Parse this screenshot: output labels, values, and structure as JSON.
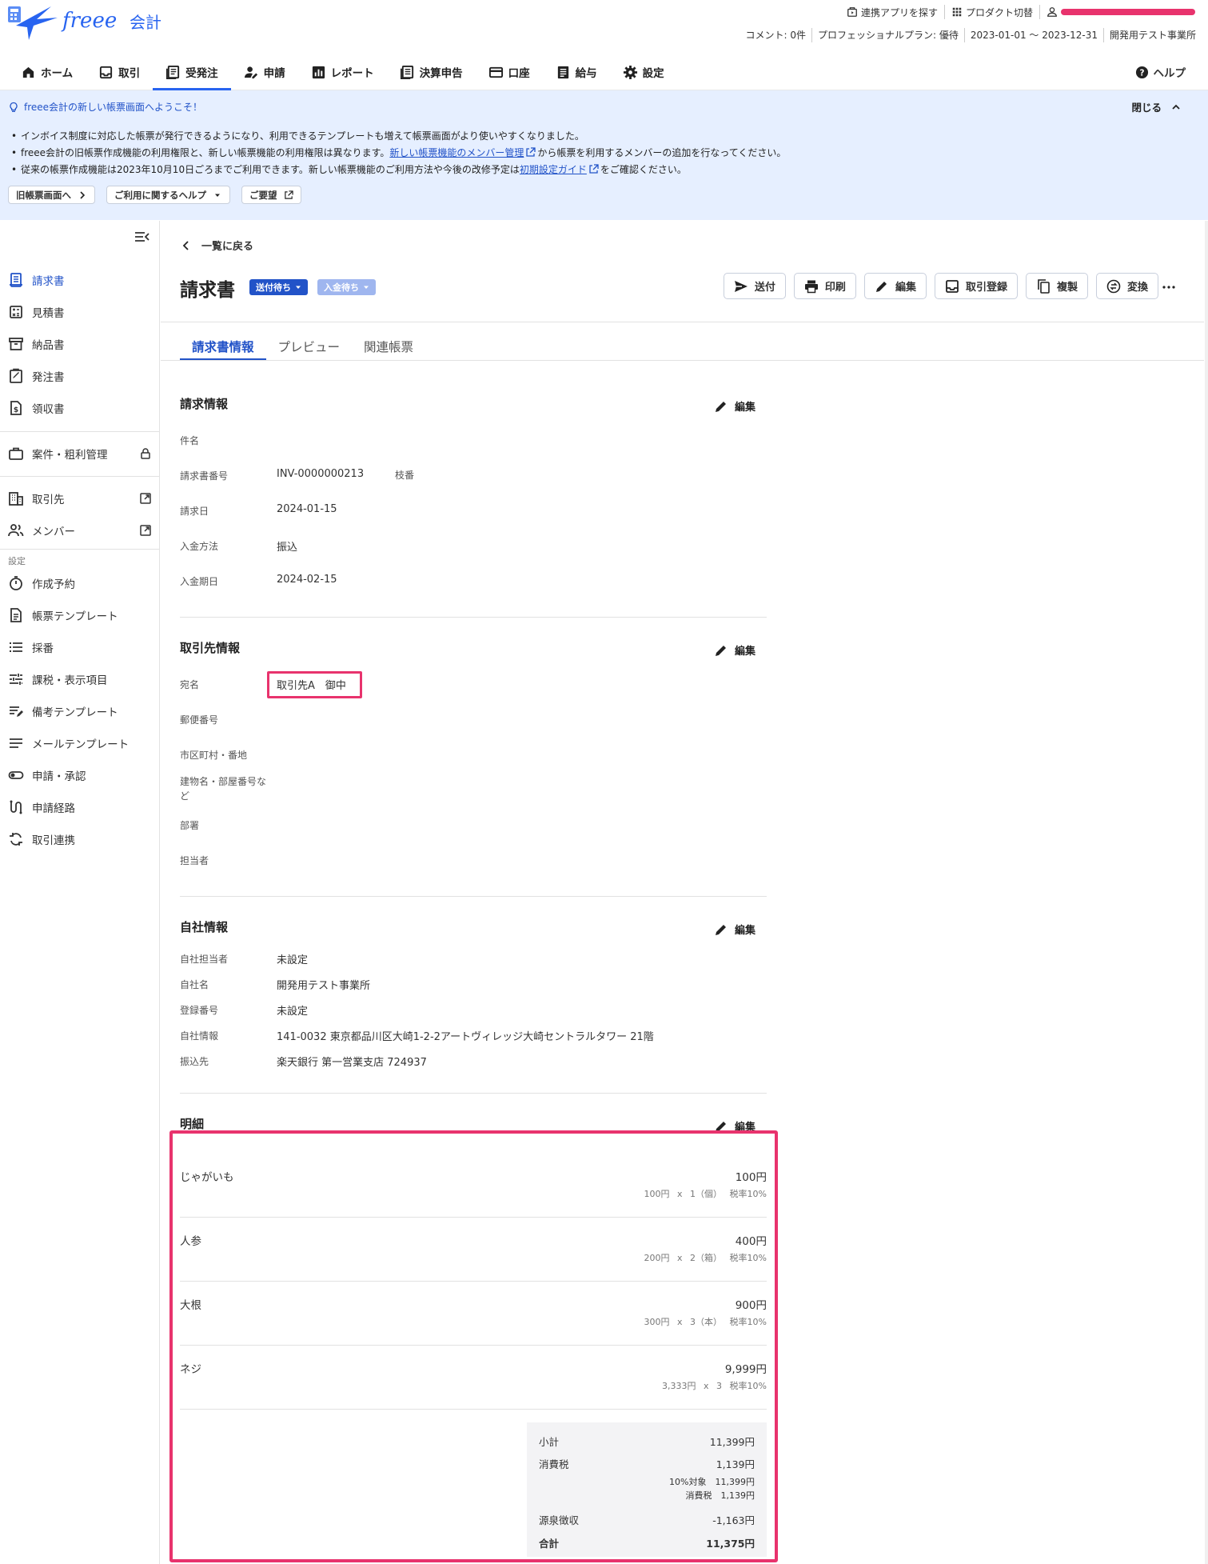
{
  "app": {
    "name": "freee 会計"
  },
  "header": {
    "tools": [
      {
        "icon": "app-store-icon",
        "label": "連携アプリを探す"
      },
      {
        "icon": "grid-icon",
        "label": "プロダクト切替"
      }
    ],
    "meta": [
      "コメント: 0件",
      "プロフェッショナルプラン: 優待",
      "2023-01-01 〜 2023-12-31",
      "開発用テスト事業所"
    ]
  },
  "nav": {
    "items": [
      {
        "label": "ホーム",
        "icon": "home-icon"
      },
      {
        "label": "取引",
        "icon": "transaction-icon"
      },
      {
        "label": "受発注",
        "icon": "orders-icon"
      },
      {
        "label": "申請",
        "icon": "request-icon"
      },
      {
        "label": "レポート",
        "icon": "report-icon"
      },
      {
        "label": "決算申告",
        "icon": "tax-filing-icon"
      },
      {
        "label": "口座",
        "icon": "account-icon"
      },
      {
        "label": "給与",
        "icon": "payroll-icon"
      },
      {
        "label": "設定",
        "icon": "gear-icon"
      }
    ],
    "active": "受発注",
    "help": "ヘルプ"
  },
  "banner": {
    "title": "freee会計の新しい帳票画面へようこそ！",
    "close": "閉じる",
    "line1": "インボイス制度に対応した帳票が発行できるようになり、利用できるテンプレートも増えて帳票画面がより使いやすくなりました。",
    "line2_pre": "freee会計の旧帳票作成機能の利用権限と、新しい帳票機能の利用権限は異なります。",
    "line2_link": "新しい帳票機能のメンバー管理",
    "line2_post": "から帳票を利用するメンバーの追加を行なってください。",
    "line3_pre": "従来の帳票作成機能は2023年10月10日ごろまでご利用できます。新しい帳票機能のご利用方法や今後の改修予定は",
    "line3_link": "初期設定ガイド",
    "line3_post": "をご確認ください。",
    "buttons": [
      "旧帳票画面へ",
      "ご利用に関するヘルプ",
      "ご要望"
    ]
  },
  "sidebar": {
    "items": [
      {
        "label": "請求書",
        "icon": "invoice-icon"
      },
      {
        "label": "見積書",
        "icon": "calculator-icon"
      },
      {
        "label": "納品書",
        "icon": "delivery-box-icon"
      },
      {
        "label": "発注書",
        "icon": "purchase-order-icon"
      },
      {
        "label": "領収書",
        "icon": "receipt-icon"
      },
      {
        "label": "案件・粗利管理",
        "icon": "briefcase-icon"
      },
      {
        "label": "取引先",
        "icon": "building-icon"
      },
      {
        "label": "メンバー",
        "icon": "members-icon"
      }
    ],
    "settings_heading": "設定",
    "settings": [
      {
        "label": "作成予約",
        "icon": "timer-icon"
      },
      {
        "label": "帳票テンプレート",
        "icon": "template-icon"
      },
      {
        "label": "採番",
        "icon": "numbered-list-icon"
      },
      {
        "label": "課税・表示項目",
        "icon": "sliders-icon"
      },
      {
        "label": "備考テンプレート",
        "icon": "notes-edit-icon"
      },
      {
        "label": "メールテンプレート",
        "icon": "lines-icon"
      },
      {
        "label": "申請・承認",
        "icon": "toggle-icon"
      },
      {
        "label": "申請経路",
        "icon": "route-icon"
      },
      {
        "label": "取引連携",
        "icon": "sync-icon"
      }
    ]
  },
  "page": {
    "back": "一覧に戻る",
    "title": "請求書",
    "status1": "送付待ち",
    "status2": "入金待ち",
    "actions": [
      "送付",
      "印刷",
      "編集",
      "取引登録",
      "複製",
      "変換"
    ],
    "tabs": [
      "請求書情報",
      "プレビュー",
      "関連帳票"
    ]
  },
  "billing": {
    "title": "請求情報",
    "edit": "編集",
    "fields": [
      {
        "label": "件名",
        "value": ""
      },
      {
        "label": "請求書番号",
        "value": "INV-0000000213",
        "extra": "枝番"
      },
      {
        "label": "請求日",
        "value": "2024-01-15"
      },
      {
        "label": "入金方法",
        "value": "振込"
      },
      {
        "label": "入金期日",
        "value": "2024-02-15"
      }
    ]
  },
  "partner": {
    "title": "取引先情報",
    "edit": "編集",
    "fields": [
      {
        "label": "宛名",
        "value": "取引先A　御中"
      },
      {
        "label": "郵便番号",
        "value": ""
      },
      {
        "label": "市区町村・番地",
        "value": ""
      },
      {
        "label": "建物名・部屋番号など",
        "value": ""
      },
      {
        "label": "部署",
        "value": ""
      },
      {
        "label": "担当者",
        "value": ""
      }
    ]
  },
  "company": {
    "title": "自社情報",
    "edit": "編集",
    "fields": [
      {
        "label": "自社担当者",
        "value": "未設定"
      },
      {
        "label": "自社名",
        "value": "開発用テスト事業所"
      },
      {
        "label": "登録番号",
        "value": "未設定"
      },
      {
        "label": "自社情報",
        "value": "141-0032 東京都品川区大崎1-2-2アートヴィレッジ大崎セントラルタワー 21階"
      },
      {
        "label": "振込先",
        "value": "楽天銀行 第一営業支店 724937"
      }
    ]
  },
  "details": {
    "title": "明細",
    "edit": "編集",
    "items": [
      {
        "name": "じゃがいも",
        "amount": "100円",
        "calc": "100円 x 1（個）",
        "tax": "税率10%"
      },
      {
        "name": "人参",
        "amount": "400円",
        "calc": "200円 x 2（箱）",
        "tax": "税率10%"
      },
      {
        "name": "大根",
        "amount": "900円",
        "calc": "300円 x 3（本）",
        "tax": "税率10%"
      },
      {
        "name": "ネジ",
        "amount": "9,999円",
        "calc": "3,333円 x 3",
        "tax": "税率10%"
      }
    ],
    "totals": {
      "subtotal_label": "小計",
      "subtotal": "11,399円",
      "tax_label": "消費税",
      "tax": "1,139円",
      "tax_base": "10%対象　11,399円",
      "tax_detail": "消費税　1,139円",
      "withholding_label": "源泉徴収",
      "withholding": "-1,163円",
      "total_label": "合計",
      "total": "11,375円"
    }
  }
}
